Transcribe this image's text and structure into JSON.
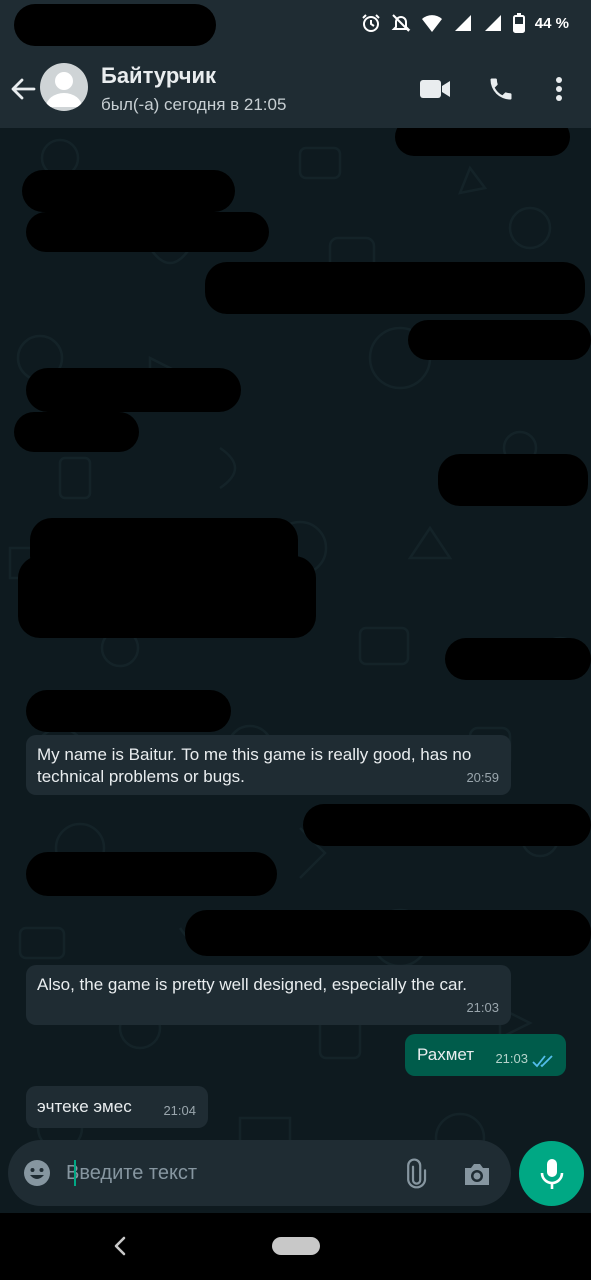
{
  "status_bar": {
    "battery": "44 %",
    "icons": [
      "alarm-icon",
      "mute-icon",
      "wifi-icon",
      "signal-icon",
      "signal-icon",
      "battery-icon"
    ]
  },
  "header": {
    "contact_name": "Байтурчик",
    "last_seen": "был(-а) сегодня в 21:05",
    "icons": [
      "back-arrow-icon",
      "avatar-icon",
      "video-call-icon",
      "phone-icon",
      "more-vert-icon"
    ]
  },
  "messages": [
    {
      "direction": "incoming",
      "text": "My name is Baitur. To me this game is really good, has no technical problems or bugs.",
      "time": "20:59"
    },
    {
      "direction": "incoming",
      "text": "Also, the game is pretty well designed, especially the car.",
      "time": "21:03"
    },
    {
      "direction": "outgoing",
      "text": "Рахмет",
      "time": "21:03",
      "status": "read"
    },
    {
      "direction": "incoming",
      "text": "эчтеке эмес",
      "time": "21:04"
    }
  ],
  "composer": {
    "placeholder": "Введите текст",
    "icons": [
      "emoji-icon",
      "attach-icon",
      "camera-icon",
      "mic-icon"
    ]
  },
  "colors": {
    "header_bg": "#1f2c33",
    "chat_bg": "#0e1a1f",
    "incoming_bubble": "#1f2c33",
    "outgoing_bubble": "#005c4b",
    "accent": "#00a884",
    "read_ticks": "#53bdeb"
  }
}
